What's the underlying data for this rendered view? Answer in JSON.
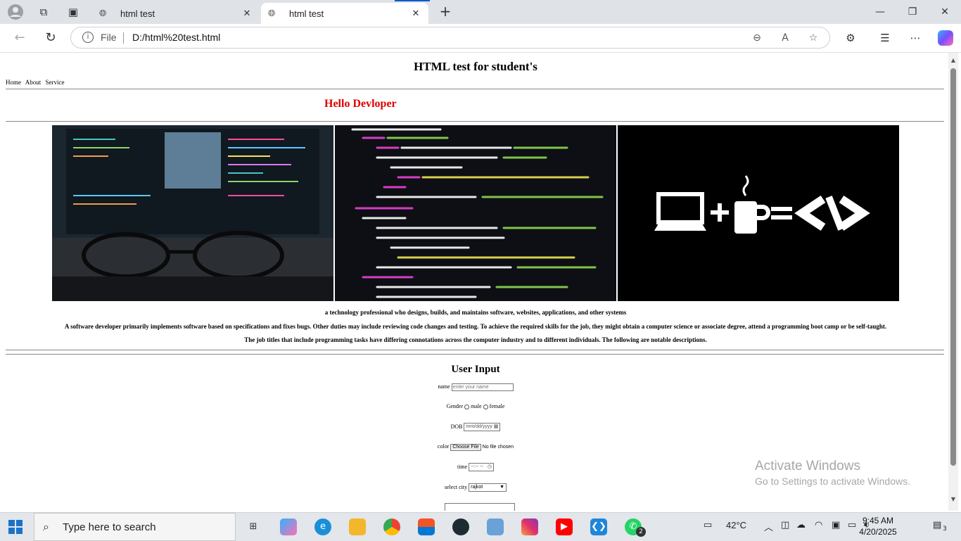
{
  "browser": {
    "tabs": [
      {
        "title": "html test",
        "active": false
      },
      {
        "title": "html test",
        "active": true
      }
    ],
    "address": {
      "scheme_label": "File",
      "url": "D:/html%20test.html"
    }
  },
  "page": {
    "title": "HTML test for student's",
    "nav": [
      "Home",
      "About",
      "Service"
    ],
    "hello": "Hello Devloper",
    "hello_color": "#e00000",
    "images": [
      {
        "name": "desk-monitor-glasses-photo"
      },
      {
        "name": "code-screen-photo"
      },
      {
        "name": "laptop-plus-coffee-equals-code-graphic"
      }
    ],
    "paragraphs": [
      "a technology professional who designs, builds, and maintains software, websites, applications, and other systems",
      "A software developer primarily implements software based on specifications and fixes bugs. Other duties may include reviewing code changes and testing. To achieve the required skills for the job, they might obtain a computer science or associate degree, attend a programming boot camp or be self-taught.",
      "The job titles that include programming tasks have differing connotations across the computer industry and to different individuals. The following are notable descriptions."
    ],
    "form": {
      "heading": "User Input",
      "name_label": "name",
      "name_placeholder": "enter your name",
      "gender_label": "Gender",
      "gender_options": [
        "male",
        "female"
      ],
      "dob_label": "DOB",
      "dob_placeholder": "mm/dd/yyyy",
      "color_label": "color",
      "file_button": "Choose File",
      "file_status": "No file chosen",
      "time_label": "time",
      "time_placeholder": "--:-- --",
      "city_label": "select city",
      "city_value": "rajkot"
    },
    "watermark": {
      "line1": "Activate Windows",
      "line2": "Go to Settings to activate Windows."
    }
  },
  "taskbar": {
    "search_placeholder": "Type here to search",
    "weather": "42°C",
    "time": "9:45 AM",
    "date": "4/20/2025",
    "whatsapp_badge": "2",
    "notification_count": "3"
  }
}
